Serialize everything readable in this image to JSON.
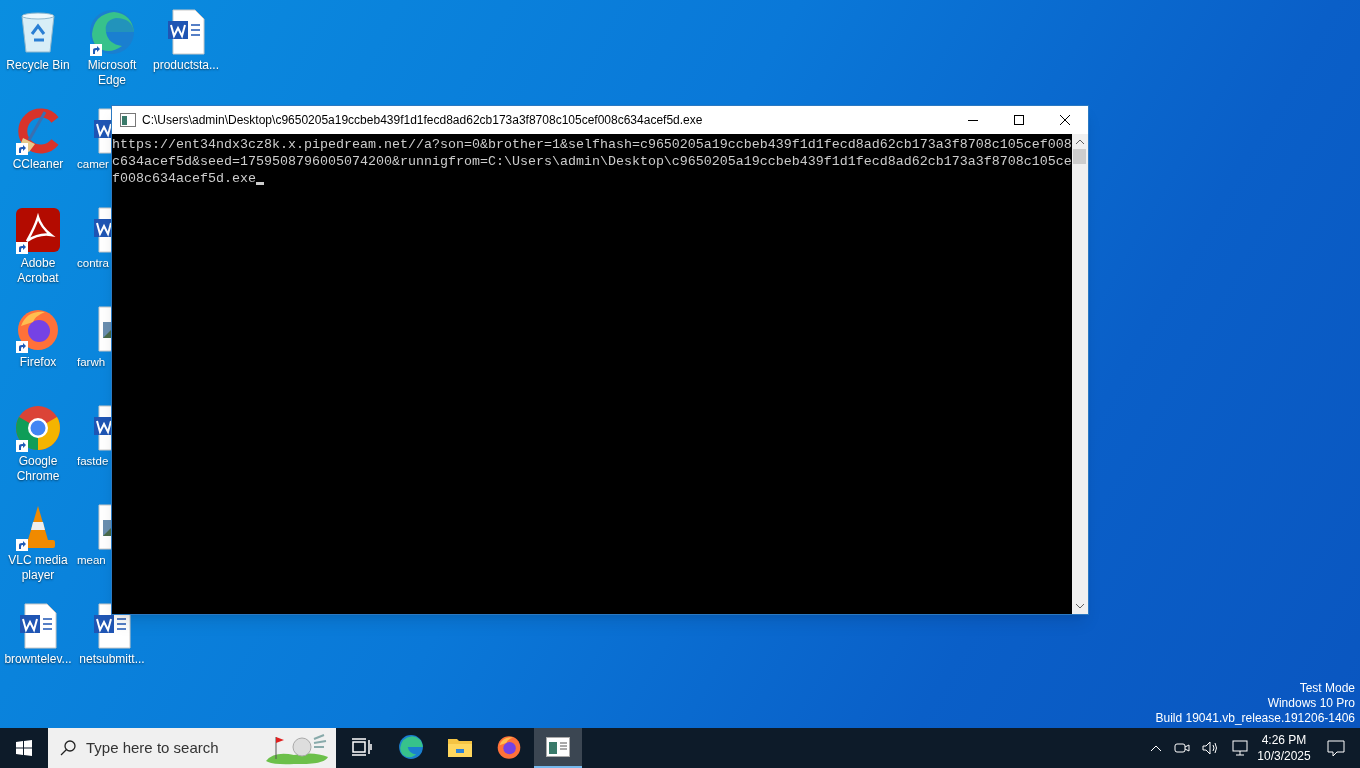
{
  "desktop": {
    "icons": [
      {
        "label": "Recycle Bin",
        "kind": "recycle-bin",
        "shortcut": false,
        "covered": false
      },
      {
        "label": "CCleaner",
        "kind": "ccleaner",
        "shortcut": true,
        "covered": false
      },
      {
        "label": "Adobe Acrobat",
        "kind": "acrobat",
        "shortcut": true,
        "covered": false
      },
      {
        "label": "Firefox",
        "kind": "firefox",
        "shortcut": true,
        "covered": false
      },
      {
        "label": "Google Chrome",
        "kind": "chrome",
        "shortcut": true,
        "covered": false
      },
      {
        "label": "VLC media player",
        "kind": "vlc",
        "shortcut": true,
        "covered": false
      },
      {
        "label": "browntelev...",
        "kind": "word",
        "shortcut": false,
        "covered": false
      },
      {
        "label": "Microsoft Edge",
        "kind": "edge",
        "shortcut": true,
        "covered": false
      },
      {
        "label": "camer",
        "kind": "word",
        "shortcut": false,
        "covered": true
      },
      {
        "label": "contra",
        "kind": "word",
        "shortcut": false,
        "covered": true
      },
      {
        "label": "farwh",
        "kind": "image",
        "shortcut": false,
        "covered": true
      },
      {
        "label": "fastde",
        "kind": "word",
        "shortcut": false,
        "covered": true
      },
      {
        "label": "mean",
        "kind": "image",
        "shortcut": false,
        "covered": true
      },
      {
        "label": "netsubmitt...",
        "kind": "word",
        "shortcut": false,
        "covered": false
      },
      {
        "label": "productsta...",
        "kind": "word",
        "shortcut": false,
        "covered": false
      }
    ],
    "os_notice": [
      "Test Mode",
      "Windows 10 Pro",
      "Build 19041.vb_release.191206-1406"
    ]
  },
  "console_window": {
    "title": "C:\\Users\\admin\\Desktop\\c9650205a19ccbeb439f1d1fecd8ad62cb173a3f8708c105cef008c634acef5d.exe",
    "lines": [
      "https://ent34ndx3cz8k.x.pipedream.net//a?son=0&brother=1&selfhash=c9650205a19ccbeb439f1d1fecd8ad62cb173a3f8708c105cef008",
      "c634acef5d&seed=1759508796005074200&runnigfrom=C:\\Users\\admin\\Desktop\\c9650205a19ccbeb439f1d1fecd8ad62cb173a3f8708c105ce",
      "f008c634acef5d.exe"
    ]
  },
  "taskbar": {
    "search": {
      "placeholder": "Type here to search"
    },
    "apps": [
      {
        "kind": "task-view",
        "active": false
      },
      {
        "kind": "edge",
        "active": false
      },
      {
        "kind": "explorer",
        "active": false
      },
      {
        "kind": "firefox",
        "active": false
      },
      {
        "kind": "console",
        "active": true
      }
    ],
    "tray": [
      {
        "kind": "chevron"
      },
      {
        "kind": "camera"
      },
      {
        "kind": "speaker"
      },
      {
        "kind": "network"
      }
    ],
    "clock": {
      "time": "4:26 PM",
      "date": "10/3/2025"
    }
  }
}
